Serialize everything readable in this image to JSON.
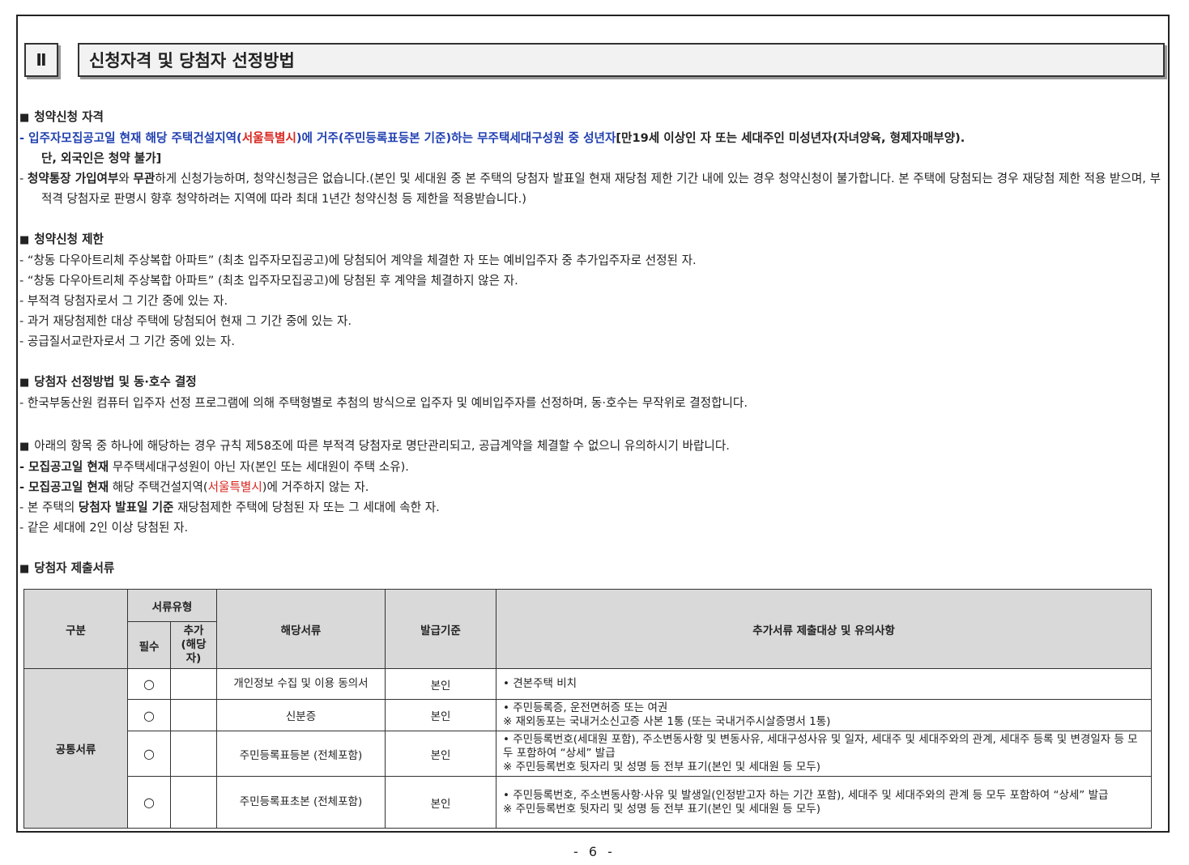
{
  "section": {
    "num": "Ⅱ",
    "title": "신청자격 및 당첨자 선정방법"
  },
  "s1": {
    "heading": "청약신청 자격",
    "l1a": "- 입주자모집공고일 현재 해당 주택건설지역(",
    "l1b": "서울특별시",
    "l1c": ")에 거주(주민등록표등본 기준)하는 무주택세대구성원 중 성년자",
    "l1d": "[만19세 이상인 자 또는 세대주인 미성년자(자녀양육, 형제자매부양).",
    "l1e": "단, 외국인은 청약 불가]",
    "l2a": "- ",
    "l2b": "청약통장 가입여부",
    "l2c": "와 ",
    "l2d": "무관",
    "l2e": "하게 신청가능하며, 청약신청금은 없습니다.(본인 및 세대원 중 본 주택의 당첨자 발표일 현재 재당첨 제한 기간 내에 있는 경우 청약신청이 불가합니다. 본 주택에 당첨되는 경우 재당첨 제한 적용 받으며, 부적격 당첨자로 판명시 향후 청약하려는 지역에 따라 최대 1년간 청약신청 등 제한을 적용받습니다.)"
  },
  "s2": {
    "heading": "청약신청 제한",
    "items": [
      "- “창동 다우아트리체 주상복합 아파트” (최초 입주자모집공고)에 당첨되어 계약을 체결한 자 또는 예비입주자 중 추가입주자로 선정된 자.",
      "- “창동 다우아트리체 주상복합 아파트” (최초 입주자모집공고)에 당첨된 후 계약을 체결하지 않은 자.",
      "- 부적격 당첨자로서 그 기간 중에 있는 자.",
      "- 과거 재당첨제한 대상 주택에 당첨되어 현재 그 기간 중에 있는 자.",
      "- 공급질서교란자로서 그 기간 중에 있는 자."
    ]
  },
  "s3": {
    "heading": "당첨자 선정방법 및 동·호수 결정",
    "l1": "- 한국부동산원 컴퓨터 입주자 선정 프로그램에 의해 주택형별로 추첨의 방식으로 입주자 및 예비입주자를 선정하며, 동·호수는 무작위로 결정합니다."
  },
  "s4": {
    "heading": "아래의 항목 중 하나에 해당하는 경우 규칙 제58조에 따른 부적격 당첨자로 명단관리되고, 공급계약을 체결할 수 없으니 유의하시기 바랍니다.",
    "l1a": "모집공고일 현재",
    "l1b": " 무주택세대구성원이 아닌 자(본인 또는 세대원이 주택 소유).",
    "l2a": "모집공고일 현재",
    "l2b": " 해당 주택건설지역(",
    "l2c": "서울특별시",
    "l2d": ")에 거주하지 않는 자.",
    "l3a": "- 본 주택의 ",
    "l3b": "당첨자 발표일 기준",
    "l3c": " 재당첨제한 주택에 당첨된 자 또는 그 세대에 속한 자.",
    "l4": "- 같은 세대에 2인 이상 당첨된 자.",
    "dash": "- "
  },
  "s5": {
    "heading": "당첨자 제출서류"
  },
  "table": {
    "h_gubun": "구분",
    "h_type": "서류유형",
    "h_req": "필수",
    "h_add": "추가 (해당 자)",
    "h_doc": "해당서류",
    "h_issue": "발급기준",
    "h_note": "추가서류 제출대상 및 유의사항",
    "group": "공통서류",
    "rows": [
      {
        "req": "○",
        "add": "",
        "doc": "개인정보 수집 및 이용 동의서",
        "issue": "본인",
        "note1": "• 견본주택 비치",
        "note2": ""
      },
      {
        "req": "○",
        "add": "",
        "doc": "신분증",
        "issue": "본인",
        "note1": "• 주민등록증, 운전면허증 또는 여권",
        "note2": "※ 재외동포는 국내거소신고증 사본 1통 (또는 국내거주시살증명서 1통)"
      },
      {
        "req": "○",
        "add": "",
        "doc": "주민등록표등본 (전체포함)",
        "issue": "본인",
        "note1": "• 주민등록번호(세대원 포함), 주소변동사항 및 변동사유, 세대구성사유 및 일자, 세대주 및 세대주와의 관계, 세대주 등록 및 변경일자 등 모두 포함하여 “상세” 발급",
        "note2": "※ 주민등록번호 뒷자리 및 성명 등 전부 표기(본인 및 세대원 등 모두)"
      },
      {
        "req": "○",
        "add": "",
        "doc": "주민등록표초본 (전체포함)",
        "issue": "본인",
        "note1": "• 주민등록번호, 주소변동사항·사유 및 발생일(인정받고자 하는 기간 포함), 세대주 및 세대주와의 관계 등 모두 포함하여 “상세” 발급",
        "note2": "※ 주민등록번호 뒷자리 및 성명 등 전부 표기(본인 및 세대원 등 모두)"
      }
    ]
  },
  "page_number": "- 6 -"
}
